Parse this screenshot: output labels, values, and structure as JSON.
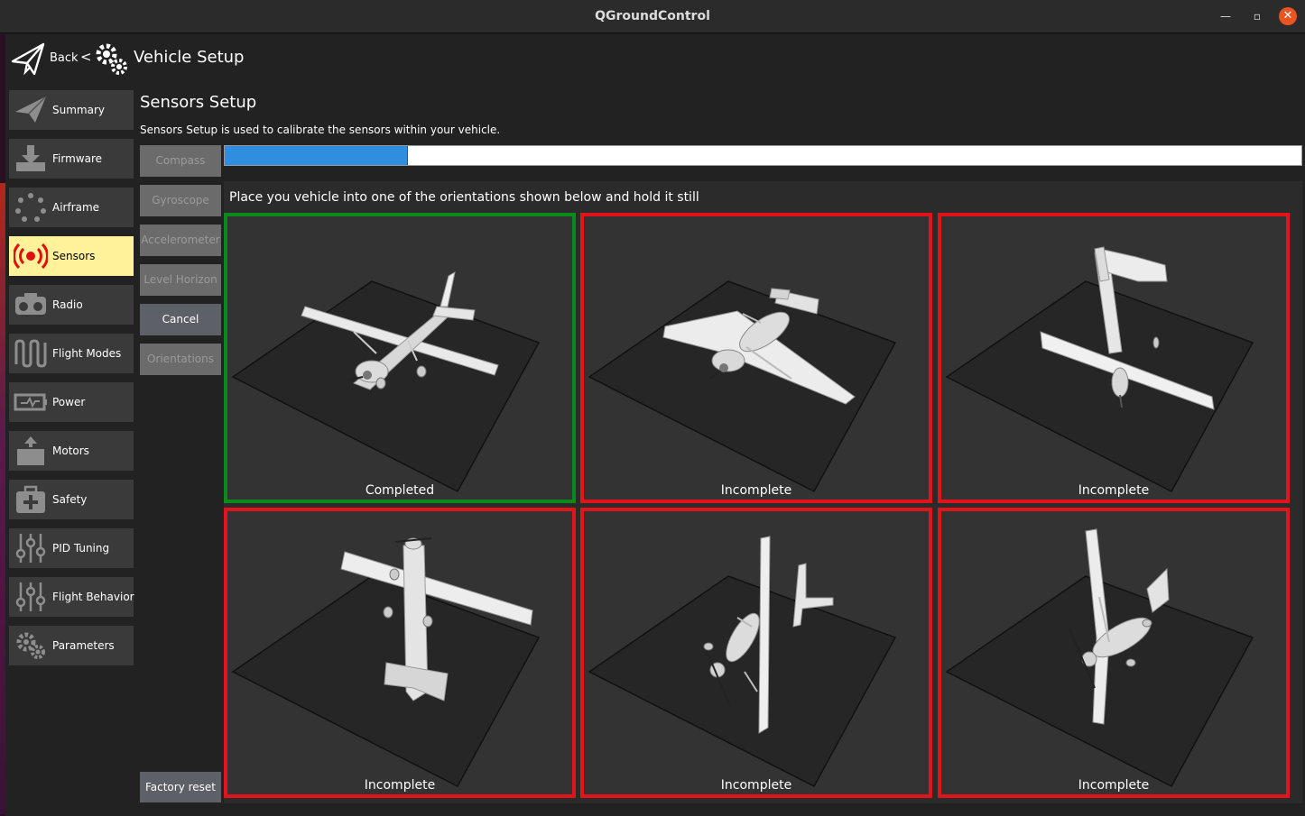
{
  "window": {
    "title": "QGroundControl",
    "close_icon": "close-icon",
    "maximize_icon": "maximize-icon",
    "minimize_icon": "minimize-icon"
  },
  "toolbar": {
    "back_label": "Back",
    "separator": "<",
    "page_title": "Vehicle Setup"
  },
  "sidebar": {
    "items": [
      {
        "label": "Summary",
        "icon": "paper-plane-icon",
        "active": false
      },
      {
        "label": "Firmware",
        "icon": "download-icon",
        "active": false
      },
      {
        "label": "Airframe",
        "icon": "airframe-icon",
        "active": false
      },
      {
        "label": "Sensors",
        "icon": "sensors-icon",
        "active": true
      },
      {
        "label": "Radio",
        "icon": "radio-icon",
        "active": false
      },
      {
        "label": "Flight Modes",
        "icon": "flight-modes-icon",
        "active": false
      },
      {
        "label": "Power",
        "icon": "power-icon",
        "active": false
      },
      {
        "label": "Motors",
        "icon": "motors-icon",
        "active": false
      },
      {
        "label": "Safety",
        "icon": "safety-icon",
        "active": false
      },
      {
        "label": "PID Tuning",
        "icon": "sliders-icon",
        "active": false
      },
      {
        "label": "Flight Behavior",
        "icon": "sliders-icon",
        "active": false
      },
      {
        "label": "Parameters",
        "icon": "gears-icon",
        "active": false
      }
    ],
    "active_color": "#fff29a"
  },
  "main": {
    "title": "Sensors Setup",
    "description": "Sensors Setup is used to calibrate the sensors within your vehicle.",
    "buttons": [
      {
        "label": "Compass",
        "enabled": false
      },
      {
        "label": "Gyroscope",
        "enabled": false
      },
      {
        "label": "Accelerometer",
        "enabled": false
      },
      {
        "label": "Level Horizon",
        "enabled": false
      },
      {
        "label": "Cancel",
        "enabled": true
      },
      {
        "label": "Orientations",
        "enabled": false
      }
    ],
    "factory_reset": "Factory reset",
    "progress": 0.17,
    "progress_color": "#2f8ee0",
    "instruction": "Place you vehicle into one of the orientations shown below and hold it still",
    "orientations": [
      {
        "status": "Completed",
        "complete": true
      },
      {
        "status": "Incomplete",
        "complete": false
      },
      {
        "status": "Incomplete",
        "complete": false
      },
      {
        "status": "Incomplete",
        "complete": false
      },
      {
        "status": "Incomplete",
        "complete": false
      },
      {
        "status": "Incomplete",
        "complete": false
      }
    ],
    "colors": {
      "complete": "#0a8a1a",
      "incomplete": "#e0141a"
    }
  }
}
